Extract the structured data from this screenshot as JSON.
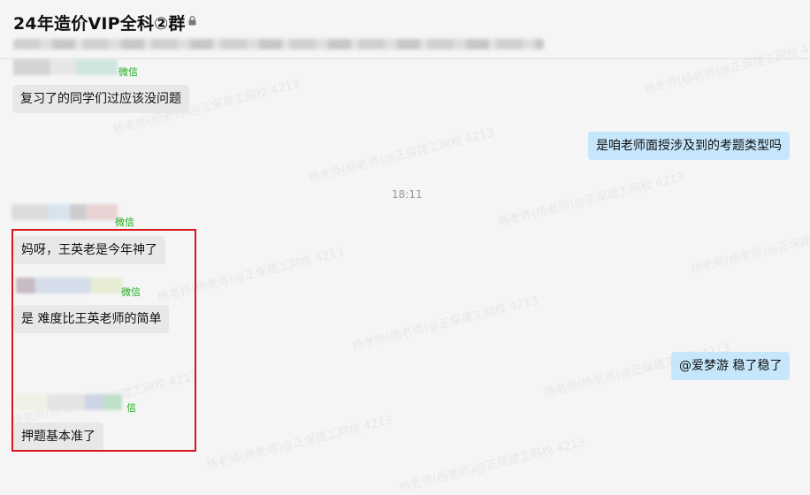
{
  "header": {
    "title": "24年造价VIP全科②群",
    "lock_icon": "lock-icon"
  },
  "watermark_text": "杨老师(杨老师)@正保建工网校 4213",
  "messages": {
    "m1": {
      "tag": "微信",
      "text": "复习了的同学们过应该没问题"
    },
    "m2": {
      "text": "是咱老师面授涉及到的考题类型吗"
    },
    "time": "18:11",
    "m3": {
      "tag": "微信",
      "text": "妈呀，王英老是今年神了"
    },
    "m4": {
      "tag": "微信",
      "text": "是 难度比王英老师的简单"
    },
    "m5": {
      "text": "@爱梦游  稳了稳了"
    },
    "m6": {
      "tag": "信",
      "text": "押题基本准了"
    }
  },
  "colors": {
    "background": "#f5f5f5",
    "bubble_left": "#e8e8e8",
    "bubble_right": "#c6e6fb",
    "highlight_border": "#d9161c",
    "wechat_tag": "#1aad19"
  }
}
